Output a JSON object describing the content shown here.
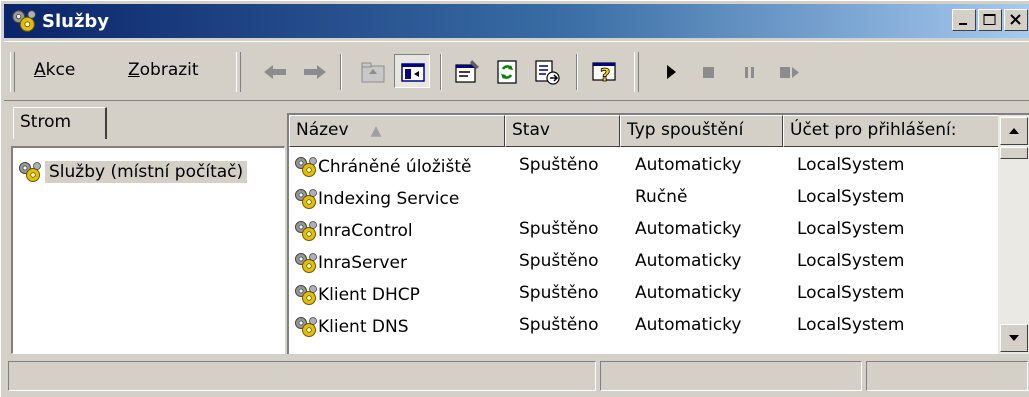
{
  "window": {
    "title": "Služby",
    "icon": "gears-icon",
    "controls": [
      "minimize-icon",
      "maximize-icon",
      "close-icon"
    ]
  },
  "menu": {
    "action": {
      "underline": "A",
      "rest": "kce"
    },
    "view": {
      "underline": "Z",
      "rest": "obrazit"
    }
  },
  "toolbar": {
    "buttons": [
      "back-arrow-icon",
      "forward-arrow-icon",
      "up-folder-icon",
      "show-hide-tree-icon",
      "properties-icon",
      "refresh-icon",
      "export-list-icon",
      "help-icon",
      "start-service-icon",
      "stop-service-icon",
      "pause-service-icon",
      "restart-service-icon"
    ]
  },
  "tree": {
    "tab_label": "Strom",
    "root_label": "Služby (místní počítač)"
  },
  "list": {
    "columns": [
      "Název",
      "Stav",
      "Typ spouštění",
      "Účet pro přihlášení:"
    ],
    "sort_indicator": "▲",
    "rows": [
      {
        "name": "Chráněné úložiště",
        "status": "Spuštěno",
        "startup": "Automaticky",
        "account": "LocalSystem"
      },
      {
        "name": "Indexing Service",
        "status": "",
        "startup": "Ručně",
        "account": "LocalSystem"
      },
      {
        "name": "InraControl",
        "status": "Spuštěno",
        "startup": "Automaticky",
        "account": "LocalSystem"
      },
      {
        "name": "InraServer",
        "status": "Spuštěno",
        "startup": "Automaticky",
        "account": "LocalSystem"
      },
      {
        "name": "Klient DHCP",
        "status": "Spuštěno",
        "startup": "Automaticky",
        "account": "LocalSystem"
      },
      {
        "name": "Klient DNS",
        "status": "Spuštěno",
        "startup": "Automaticky",
        "account": "LocalSystem"
      }
    ]
  },
  "colors": {
    "titlebar_start": "#0a246a",
    "titlebar_end": "#a6caf0",
    "face": "#d4d0c8"
  }
}
